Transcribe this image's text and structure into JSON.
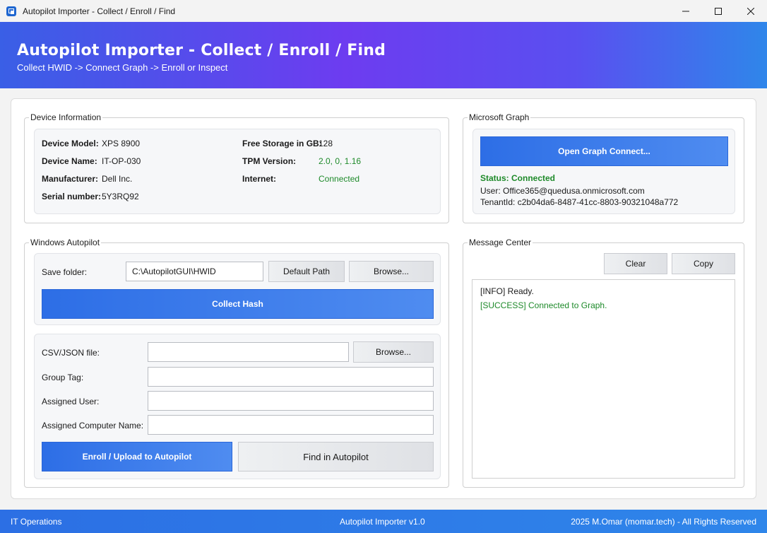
{
  "window": {
    "title": "Autopilot Importer - Collect / Enroll / Find"
  },
  "header": {
    "title": "Autopilot Importer - Collect / Enroll / Find",
    "subtitle": "Collect HWID -> Connect Graph -> Enroll or Inspect"
  },
  "device_info": {
    "legend": "Device Information",
    "model_label": "Device Model:",
    "model_value": "XPS 8900",
    "name_label": "Device Name:",
    "name_value": "IT-OP-030",
    "manufacturer_label": "Manufacturer:",
    "manufacturer_value": "Dell Inc.",
    "serial_label": "Serial number:",
    "serial_value": "5Y3RQ92",
    "storage_label": "Free Storage in GB:",
    "storage_value": "128",
    "tpm_label": "TPM Version:",
    "tpm_value": "2.0, 0, 1.16",
    "internet_label": "Internet:",
    "internet_value": "Connected"
  },
  "graph": {
    "legend": "Microsoft Graph",
    "connect_label": "Open Graph Connect...",
    "status": "Status: Connected",
    "user": "User: Office365@quedusa.onmicrosoft.com",
    "tenant": "TenantId: c2b04da6-8487-41cc-8803-90321048a772"
  },
  "autopilot": {
    "legend": "Windows Autopilot",
    "save_folder_label": "Save folder:",
    "save_folder_value": "C:\\AutopilotGUI\\HWID",
    "default_path_label": "Default Path",
    "browse_label": "Browse...",
    "collect_label": "Collect Hash",
    "csv_label": "CSV/JSON file:",
    "csv_value": "",
    "group_tag_label": "Group Tag:",
    "group_tag_value": "",
    "assigned_user_label": "Assigned User:",
    "assigned_user_value": "",
    "computer_name_label": "Assigned Computer Name:",
    "computer_name_value": "",
    "enroll_label": "Enroll / Upload to Autopilot",
    "find_label": "Find in Autopilot"
  },
  "messages": {
    "legend": "Message Center",
    "clear_label": "Clear",
    "copy_label": "Copy",
    "lines": [
      {
        "text": "[INFO] Ready.",
        "color": "#1a1a1a"
      },
      {
        "text": "[SUCCESS] Connected to Graph.",
        "color": "#1e8a2a"
      }
    ]
  },
  "footer": {
    "left": "IT Operations",
    "center": "Autopilot Importer v1.0",
    "right": "2025 M.Omar (momar.tech) - All Rights Reserved"
  },
  "colors": {
    "accent": "#2d6ee6",
    "success": "#1e8a2a"
  }
}
